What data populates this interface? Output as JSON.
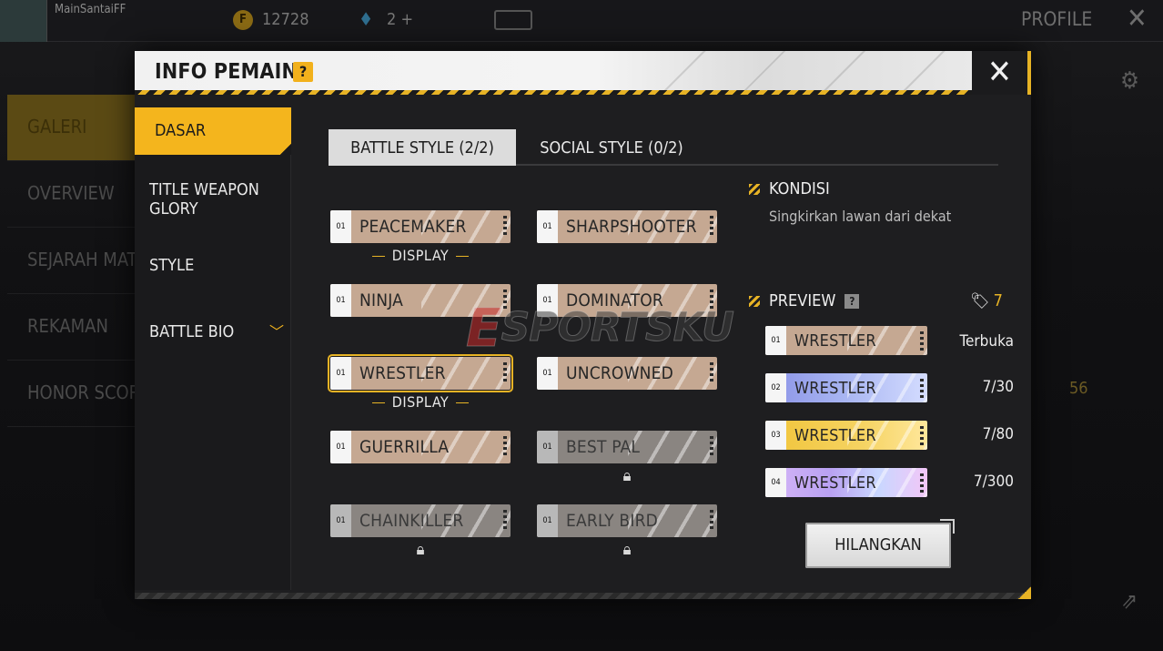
{
  "background": {
    "username": "MainSantaiFF",
    "coins": "12728",
    "diamonds": "2 +",
    "profile_label": "PROFILE",
    "sidenav": [
      "GALERI",
      "OVERVIEW",
      "SEJARAH MAT",
      "REKAMAN",
      "HONOR SCORE"
    ],
    "right_value": "56"
  },
  "modal": {
    "title": "INFO PEMAIN",
    "help_glyph": "?",
    "close_glyph": "✕",
    "menu": [
      "DASAR",
      "TITLE WEAPON GLORY",
      "STYLE",
      "BATTLE BIO"
    ],
    "tabs": {
      "battle": "BATTLE STYLE (2/2)",
      "social": "SOCIAL STYLE (0/2)"
    },
    "titles": [
      {
        "name": "PEACEMAKER",
        "level": "01",
        "tag": "DISPLAY",
        "locked": false
      },
      {
        "name": "SHARPSHOOTER",
        "level": "01",
        "locked": false
      },
      {
        "name": "NINJA",
        "level": "01",
        "locked": false
      },
      {
        "name": "DOMINATOR",
        "level": "01",
        "locked": false
      },
      {
        "name": "WRESTLER",
        "level": "01",
        "tag": "DISPLAY",
        "locked": false,
        "selected": true
      },
      {
        "name": "UNCROWNED",
        "level": "01",
        "locked": false
      },
      {
        "name": "GUERRILLA",
        "level": "01",
        "locked": false
      },
      {
        "name": "BEST PAL",
        "level": "01",
        "locked": true
      },
      {
        "name": "CHAINKILLER",
        "level": "01",
        "locked": true
      },
      {
        "name": "EARLY BIRD",
        "level": "01",
        "locked": true
      }
    ],
    "condition": {
      "heading": "KONDISI",
      "text": "Singkirkan lawan dari dekat"
    },
    "preview": {
      "heading": "PREVIEW",
      "help_glyph": "?",
      "tag_count": "7",
      "levels": [
        {
          "name": "WRESTLER",
          "level": "01",
          "status": "Terbuka",
          "style": "default"
        },
        {
          "name": "WRESTLER",
          "level": "02",
          "status": "7/30",
          "style": "blue"
        },
        {
          "name": "WRESTLER",
          "level": "03",
          "status": "7/80",
          "style": "gold"
        },
        {
          "name": "WRESTLER",
          "level": "04",
          "status": "7/300",
          "style": "rainbow"
        }
      ]
    },
    "hide_button": "HILANGKAN"
  },
  "watermark": {
    "letter": "E",
    "rest": "SPORTSKU"
  },
  "colors": {
    "accent": "#f4b51d",
    "panel": "#1e1e20",
    "card": "#c5a892"
  }
}
